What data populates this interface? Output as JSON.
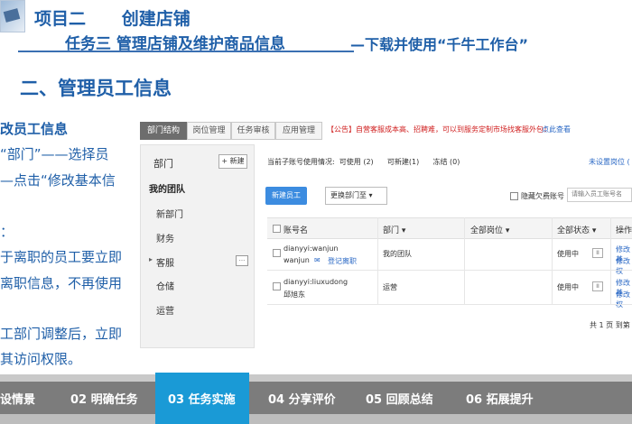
{
  "header": {
    "project_title": "项目二      创建店铺",
    "task_title": "任务三  管理店铺及维护商品信息",
    "task_sub": "—下载并使用“千牛工作台”"
  },
  "section_heading": "二、管理员工信息",
  "left_text": [
    "改员工信息",
    "“部门”——选择员",
    "—点击“修改基本信",
    "：",
    "于离职的员工要立即",
    "离职信息，不再使用",
    "工部门调整后，立即",
    "其访问权限。"
  ],
  "screenshot": {
    "tabs": [
      "部门结构",
      "岗位管理",
      "任务审核",
      "应用管理"
    ],
    "notice": "【公告】自营客服成本高、招聘难，可以到服务定制市场找客服外包！",
    "notice_link": "点此查看",
    "sidebar": {
      "title": "部门",
      "new_button": "+ 新建",
      "team_label": "我的团队",
      "items": [
        "新部门",
        "财务",
        "客服",
        "仓储",
        "运营"
      ],
      "mini_button": "···"
    },
    "summary": "当前子账号使用情况:  可使用 (2)      可新建(1)      冻结 (0)",
    "settings_link": "未设置岗位 (",
    "new_staff_button": "新建员工",
    "change_dept": "更换部门至  ▾",
    "hide_label": "隐藏欠费账号",
    "search_placeholder": "请输入员工账号名",
    "table": {
      "headers": [
        "账号名",
        "部门 ▾",
        "全部岗位 ▾",
        "全部状态 ▾",
        "操作"
      ],
      "rows": [
        {
          "account": "dianyyi:wanjun",
          "account2": "wanjun",
          "leave_icon": "✉",
          "leave": "登记离职",
          "dept": "我的团队",
          "status": "使用中",
          "pause": "II",
          "op1": "修改基",
          "op2": "修改权"
        },
        {
          "account": "dianyyi:liuxudong",
          "account2": "邱旭东",
          "dept": "运营",
          "status": "使用中",
          "pause": "II",
          "op1": "修改基",
          "op2": "修改权"
        }
      ]
    },
    "pager": "共 1 页 到第"
  },
  "bottom_nav": {
    "items": [
      "设情景",
      "02 明确任务",
      "03 任务实施",
      "04 分享评价",
      "05 回顾总结",
      "06 拓展提升"
    ],
    "active_index": 2
  },
  "colors": {
    "title_blue": "#1f5fa8",
    "nav_active": "#1a9ad6",
    "nav_bar": "#7c7c7c",
    "notice_red": "#d02020",
    "button_blue": "#3c8ce0"
  }
}
